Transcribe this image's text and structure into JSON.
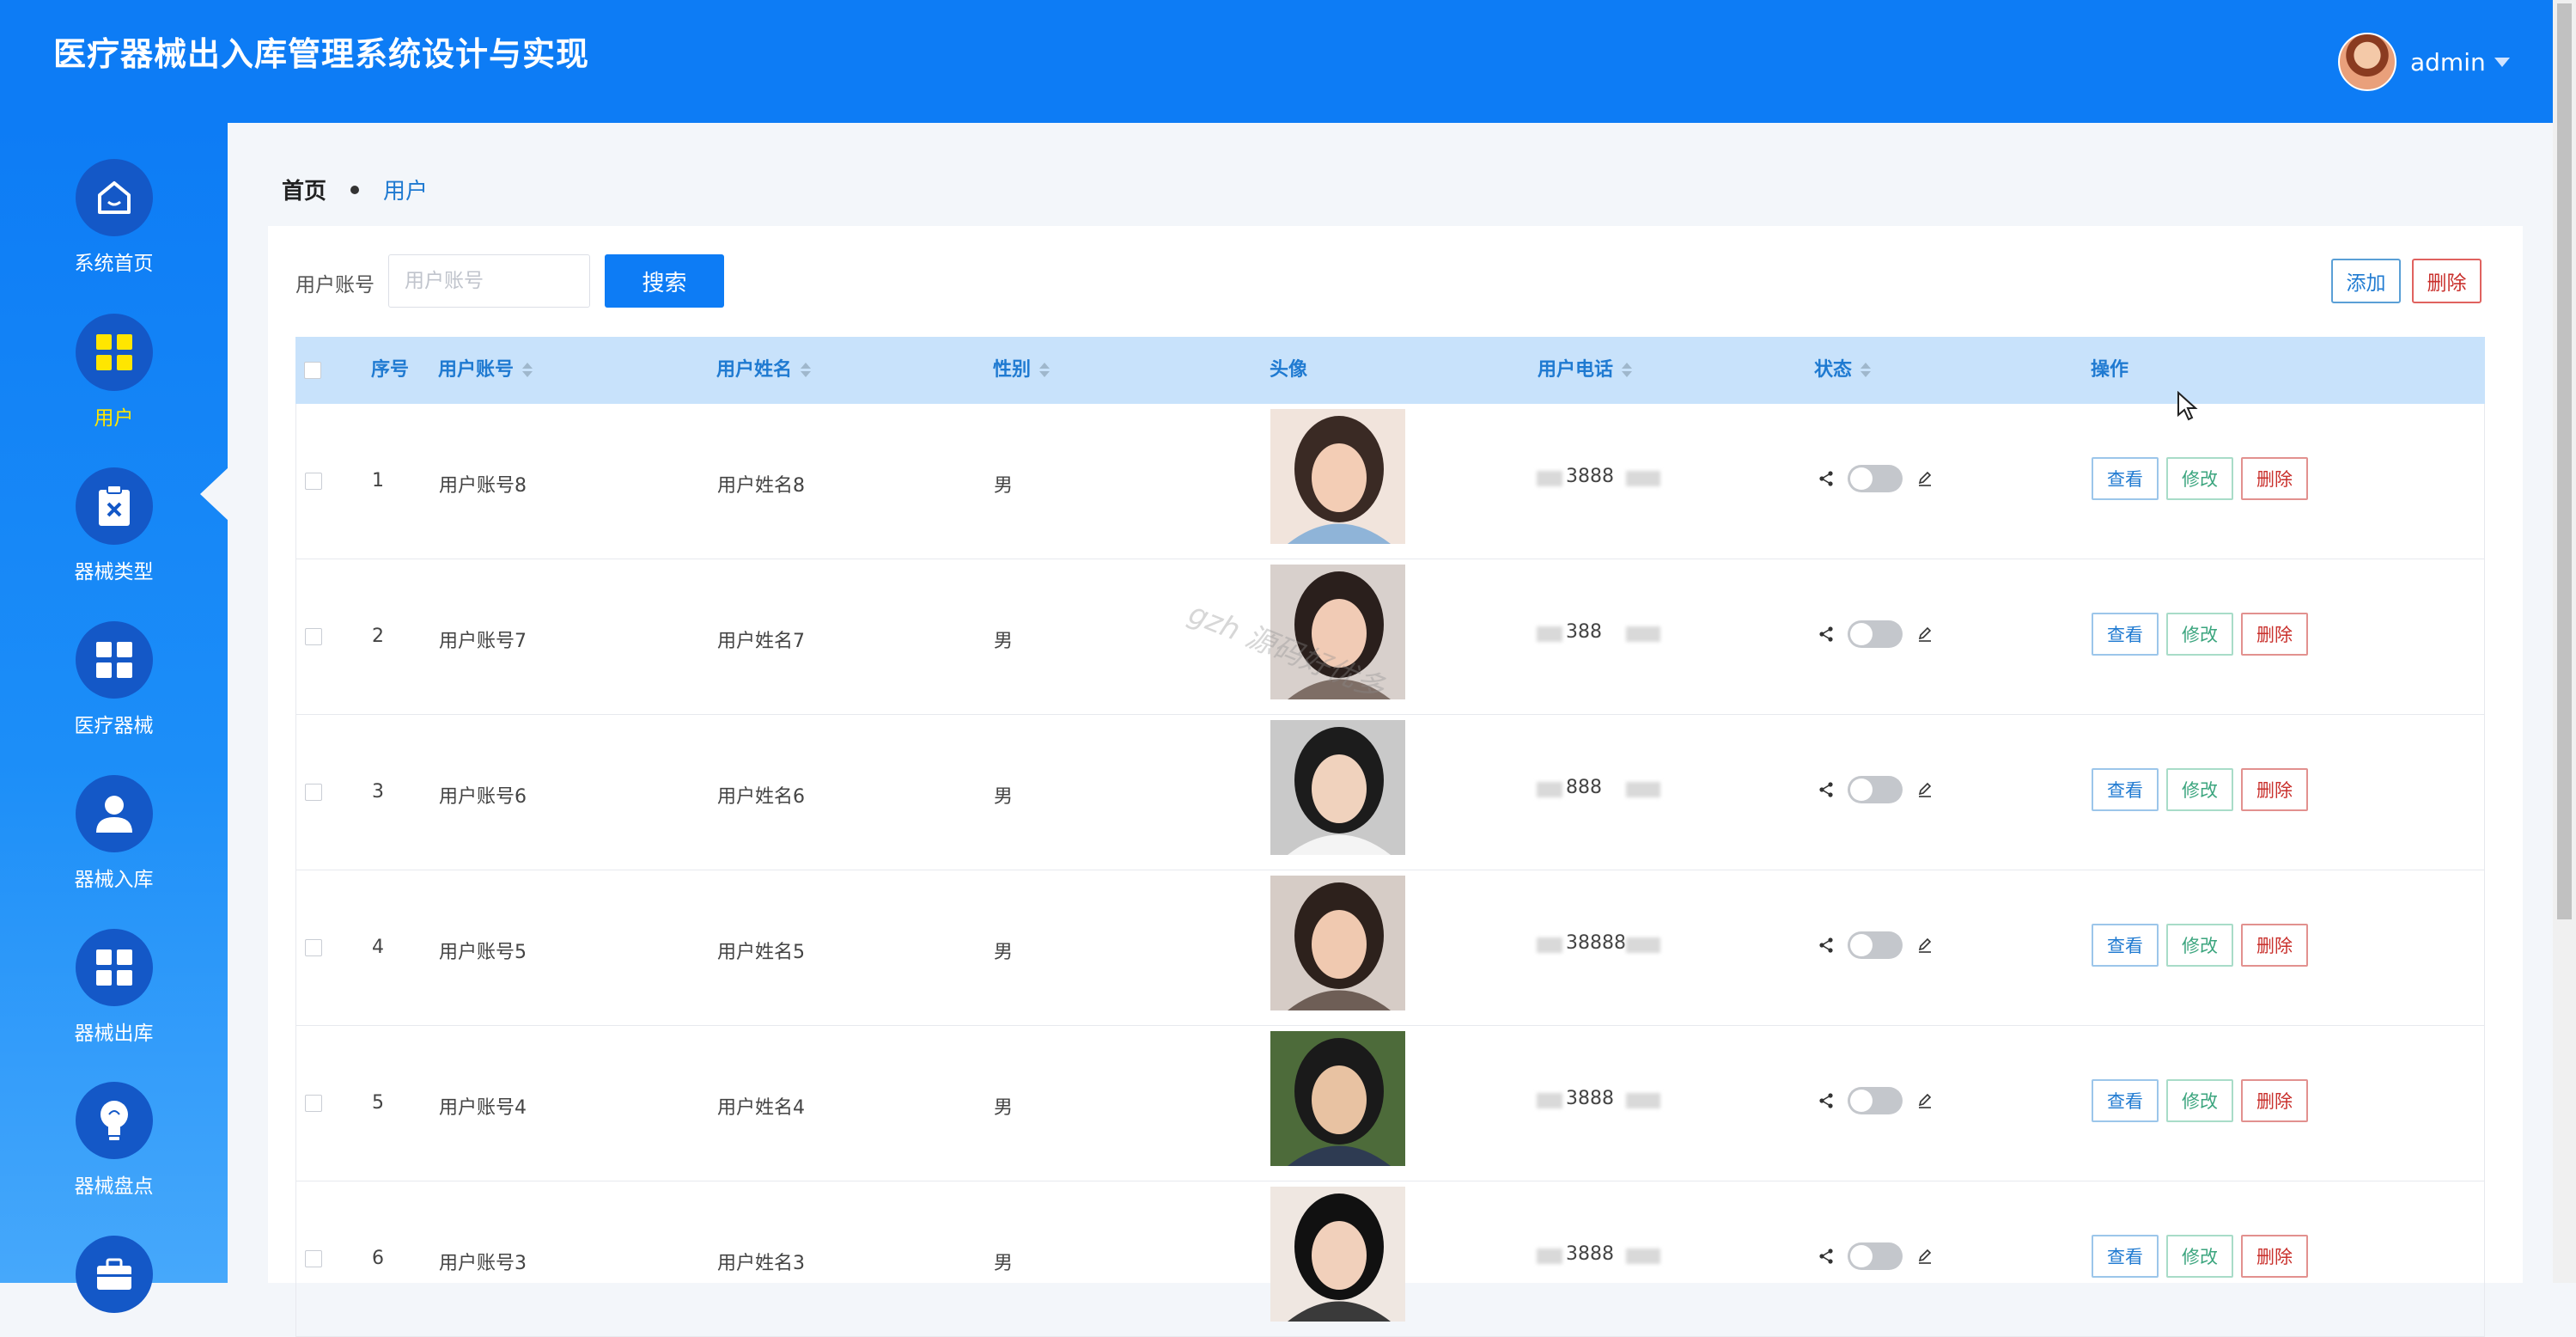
{
  "header": {
    "title": "医疗器械出入库管理系统设计与实现",
    "username": "admin"
  },
  "sidebar": {
    "items": [
      {
        "label": "系统首页",
        "icon": "home-icon",
        "active": false
      },
      {
        "label": "用户",
        "icon": "grid-icon",
        "active": true
      },
      {
        "label": "器械类型",
        "icon": "clipboard-x-icon",
        "active": false
      },
      {
        "label": "医疗器械",
        "icon": "grid-icon",
        "active": false
      },
      {
        "label": "器械入库",
        "icon": "user-icon",
        "active": false
      },
      {
        "label": "器械出库",
        "icon": "grid-icon",
        "active": false
      },
      {
        "label": "器械盘点",
        "icon": "bulb-icon",
        "active": false
      },
      {
        "label": "",
        "icon": "briefcase-icon",
        "active": false
      }
    ]
  },
  "breadcrumb": {
    "home": "首页",
    "current": "用户"
  },
  "search": {
    "label": "用户账号",
    "placeholder": "用户账号",
    "button": "搜索"
  },
  "toolbar": {
    "add": "添加",
    "delete": "删除"
  },
  "table": {
    "columns": [
      "序号",
      "用户账号",
      "用户姓名",
      "性别",
      "头像",
      "用户电话",
      "状态",
      "操作"
    ],
    "rows": [
      {
        "index": "1",
        "account": "用户账号8",
        "name": "用户姓名8",
        "gender": "男",
        "phone_visible": "3888"
      },
      {
        "index": "2",
        "account": "用户账号7",
        "name": "用户姓名7",
        "gender": "男",
        "phone_visible": "388"
      },
      {
        "index": "3",
        "account": "用户账号6",
        "name": "用户姓名6",
        "gender": "男",
        "phone_visible": "888"
      },
      {
        "index": "4",
        "account": "用户账号5",
        "name": "用户姓名5",
        "gender": "男",
        "phone_visible": "38888"
      },
      {
        "index": "5",
        "account": "用户账号4",
        "name": "用户姓名4",
        "gender": "男",
        "phone_visible": "3888"
      },
      {
        "index": "6",
        "account": "用户账号3",
        "name": "用户姓名3",
        "gender": "男",
        "phone_visible": "3888"
      }
    ],
    "actions": {
      "view": "查看",
      "edit": "修改",
      "delete": "删除"
    }
  },
  "watermark": "gzh 源码好优多",
  "colors": {
    "primary": "#0d7cf5",
    "sidebar_dark": "#1458c7",
    "active_label": "#ffe600",
    "table_header": "#c8e2fb",
    "danger": "#c9302c",
    "success": "#3ba57e"
  }
}
